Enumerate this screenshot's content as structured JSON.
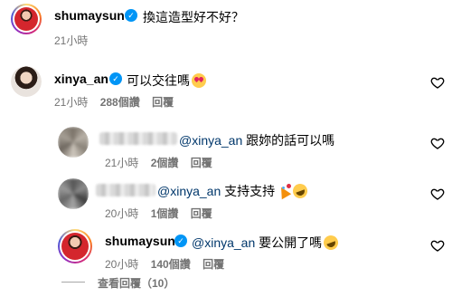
{
  "post": {
    "username": "shumaysun",
    "caption": "換這造型好不好？",
    "time": "21小時"
  },
  "comment1": {
    "username": "xinya_an",
    "text": "可以交往嗎",
    "emoji": "smiling-face-with-heart-eyes",
    "time": "21小時",
    "likes": "288個讚",
    "reply": "回覆"
  },
  "reply1": {
    "mention": "@xinya_an",
    "text": "跟妳的話可以嗎",
    "time": "21小時",
    "likes": "2個讚",
    "reply": "回覆"
  },
  "reply2": {
    "mention": "@xinya_an",
    "text": "支持支持",
    "emoji": [
      "party-popper",
      "rolling-on-floor-laughing"
    ],
    "time": "20小時",
    "likes": "1個讚",
    "reply": "回覆"
  },
  "reply3": {
    "username": "shumaysun",
    "mention": "@xinya_an",
    "text": "要公開了嗎",
    "emoji": "rolling-on-floor-laughing",
    "time": "20小時",
    "likes": "140個讚",
    "reply": "回覆"
  },
  "view_replies": "查看回覆（10）",
  "icons": {
    "verified": "verified-badge-icon",
    "like": "heart-outline-icon"
  },
  "colors": {
    "verified": "#0095f6",
    "mention": "#00376b",
    "meta": "#737373"
  }
}
